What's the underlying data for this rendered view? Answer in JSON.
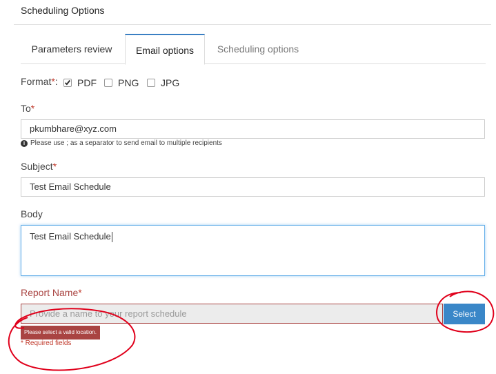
{
  "header": {
    "title": "Scheduling Options"
  },
  "tabs": [
    {
      "label": "Parameters review"
    },
    {
      "label": "Email options"
    },
    {
      "label": "Scheduling options"
    }
  ],
  "format": {
    "label": "Format",
    "required_mark": "*",
    "colon": ":",
    "options": [
      {
        "label": "PDF",
        "checked": true
      },
      {
        "label": "PNG",
        "checked": false
      },
      {
        "label": "JPG",
        "checked": false
      }
    ]
  },
  "to": {
    "label": "To",
    "required_mark": "*",
    "value": "pkumbhare@xyz.com",
    "help": "Please use ; as a separator to send email to multiple recipients"
  },
  "subject": {
    "label": "Subject",
    "required_mark": "*",
    "value": "Test Email Schedule"
  },
  "body": {
    "label": "Body",
    "value": "Test Email Schedule"
  },
  "report_name": {
    "label": "Report Name",
    "required_mark": "*",
    "placeholder": "Provide a name to your report schedule",
    "select_label": "Select",
    "error": "Please select a valid location.",
    "required_note": "* Required fields"
  },
  "colors": {
    "accent": "#3a87c8",
    "error": "#a94442",
    "annotation": "#e0001b"
  }
}
